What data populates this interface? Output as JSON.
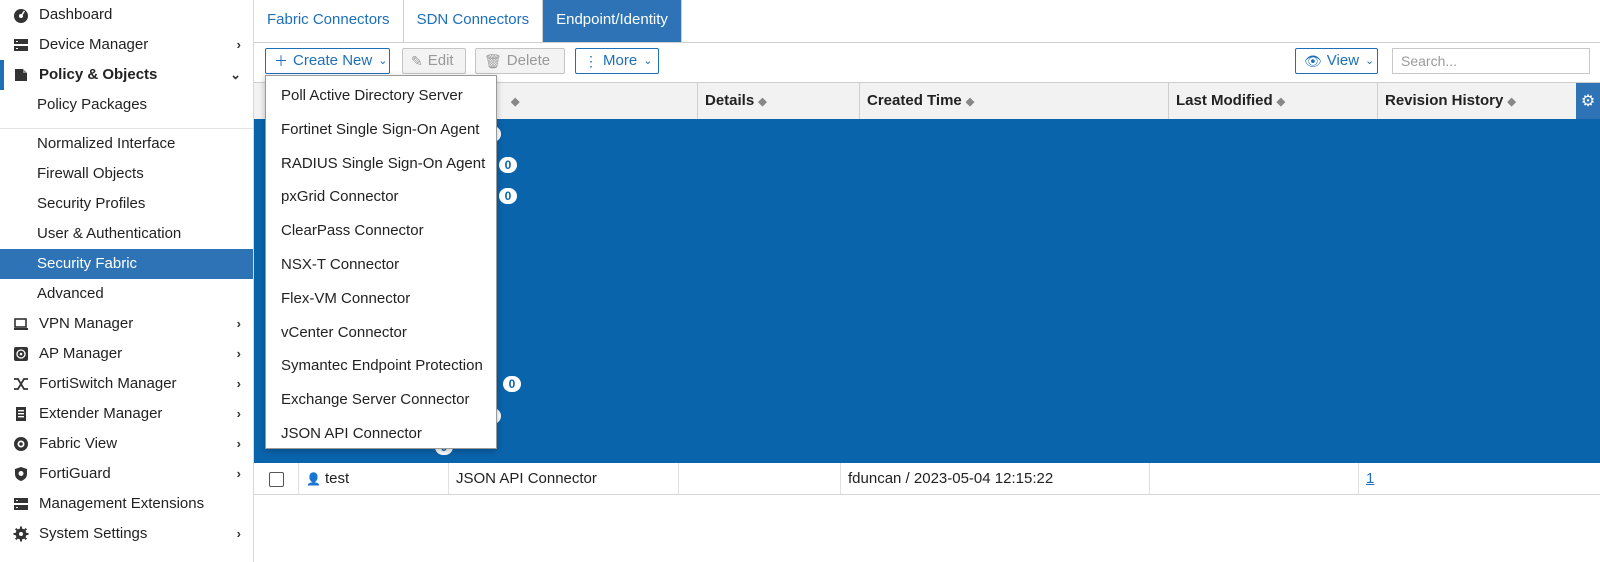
{
  "sidebar": {
    "items": [
      {
        "label": "Dashboard",
        "icon": "dashboard-icon",
        "chevron": ""
      },
      {
        "label": "Device Manager",
        "icon": "device-manager-icon",
        "chevron": "›"
      },
      {
        "label": "Policy & Objects",
        "icon": "policy-objects-icon",
        "chevron": "⌄"
      }
    ],
    "policy_submenu": [
      {
        "label": "Policy Packages"
      },
      {
        "label": "Normalized Interface"
      },
      {
        "label": "Firewall Objects"
      },
      {
        "label": "Security Profiles"
      },
      {
        "label": "User & Authentication"
      },
      {
        "label": "Security Fabric",
        "selected": true
      },
      {
        "label": "Advanced"
      }
    ],
    "lower_items": [
      {
        "label": "VPN Manager",
        "icon": "vpn-manager-icon",
        "chevron": "›"
      },
      {
        "label": "AP Manager",
        "icon": "ap-manager-icon",
        "chevron": "›"
      },
      {
        "label": "FortiSwitch Manager",
        "icon": "fortiswitch-icon",
        "chevron": "›"
      },
      {
        "label": "Extender Manager",
        "icon": "extender-icon",
        "chevron": "›"
      },
      {
        "label": "Fabric View",
        "icon": "fabric-view-icon",
        "chevron": "›"
      },
      {
        "label": "FortiGuard",
        "icon": "fortiguard-icon",
        "chevron": "›"
      },
      {
        "label": "Management Extensions",
        "icon": "management-extensions-icon",
        "chevron": ""
      },
      {
        "label": "System Settings",
        "icon": "gear-icon",
        "chevron": "›"
      }
    ]
  },
  "tabs": [
    {
      "label": "Fabric Connectors",
      "active": false
    },
    {
      "label": "SDN Connectors",
      "active": false
    },
    {
      "label": "Endpoint/Identity",
      "active": true
    }
  ],
  "toolbar": {
    "create_new": "Create New",
    "edit": "Edit",
    "delete": "Delete",
    "more": "More",
    "view": "View",
    "search_placeholder": "Search..."
  },
  "table": {
    "columns": [
      "",
      "",
      "",
      "Details",
      "Created Time",
      "Last Modified",
      "Revision History"
    ],
    "group_counts": [
      "0",
      "0",
      "0",
      "0",
      "0",
      "0"
    ],
    "rows": [
      {
        "name": "test",
        "type": "JSON API Connector",
        "details": "",
        "created": "fduncan / 2023-05-04 12:15:22",
        "modified": "",
        "revision": "1"
      }
    ]
  },
  "dropdown": {
    "items": [
      "Poll Active Directory Server",
      "Fortinet Single Sign-On Agent",
      "RADIUS Single Sign-On Agent",
      "pxGrid Connector",
      "ClearPass Connector",
      "NSX-T Connector",
      "Flex-VM Connector",
      "vCenter Connector",
      "Symantec Endpoint Protection",
      "Exchange Server Connector",
      "JSON API Connector"
    ]
  },
  "colors": {
    "accent": "#1d6fb8",
    "selected_bg": "#2d73b6",
    "group_bg": "#0a64ac"
  }
}
